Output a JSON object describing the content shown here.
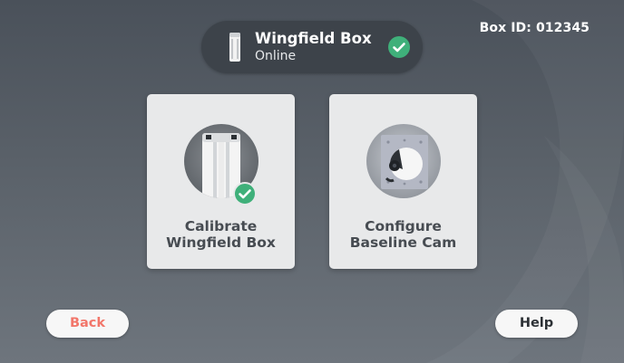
{
  "header": {
    "box_id_label": "Box ID: 012345"
  },
  "device_status": {
    "name": "Wingfield Box",
    "status": "Online",
    "status_icon": "check-circle-icon"
  },
  "cards": [
    {
      "label_line1": "Calibrate",
      "label_line2": "Wingfield Box",
      "image": "wingfield-box-image",
      "completed": true
    },
    {
      "label_line1": "Configure",
      "label_line2": "Baseline Cam",
      "image": "baseline-cam-image",
      "completed": false
    }
  ],
  "footer": {
    "back_label": "Back",
    "help_label": "Help"
  },
  "colors": {
    "accent_green": "#3fb07a",
    "back_text": "#f2766a",
    "pill_bg": "#3d434a"
  }
}
